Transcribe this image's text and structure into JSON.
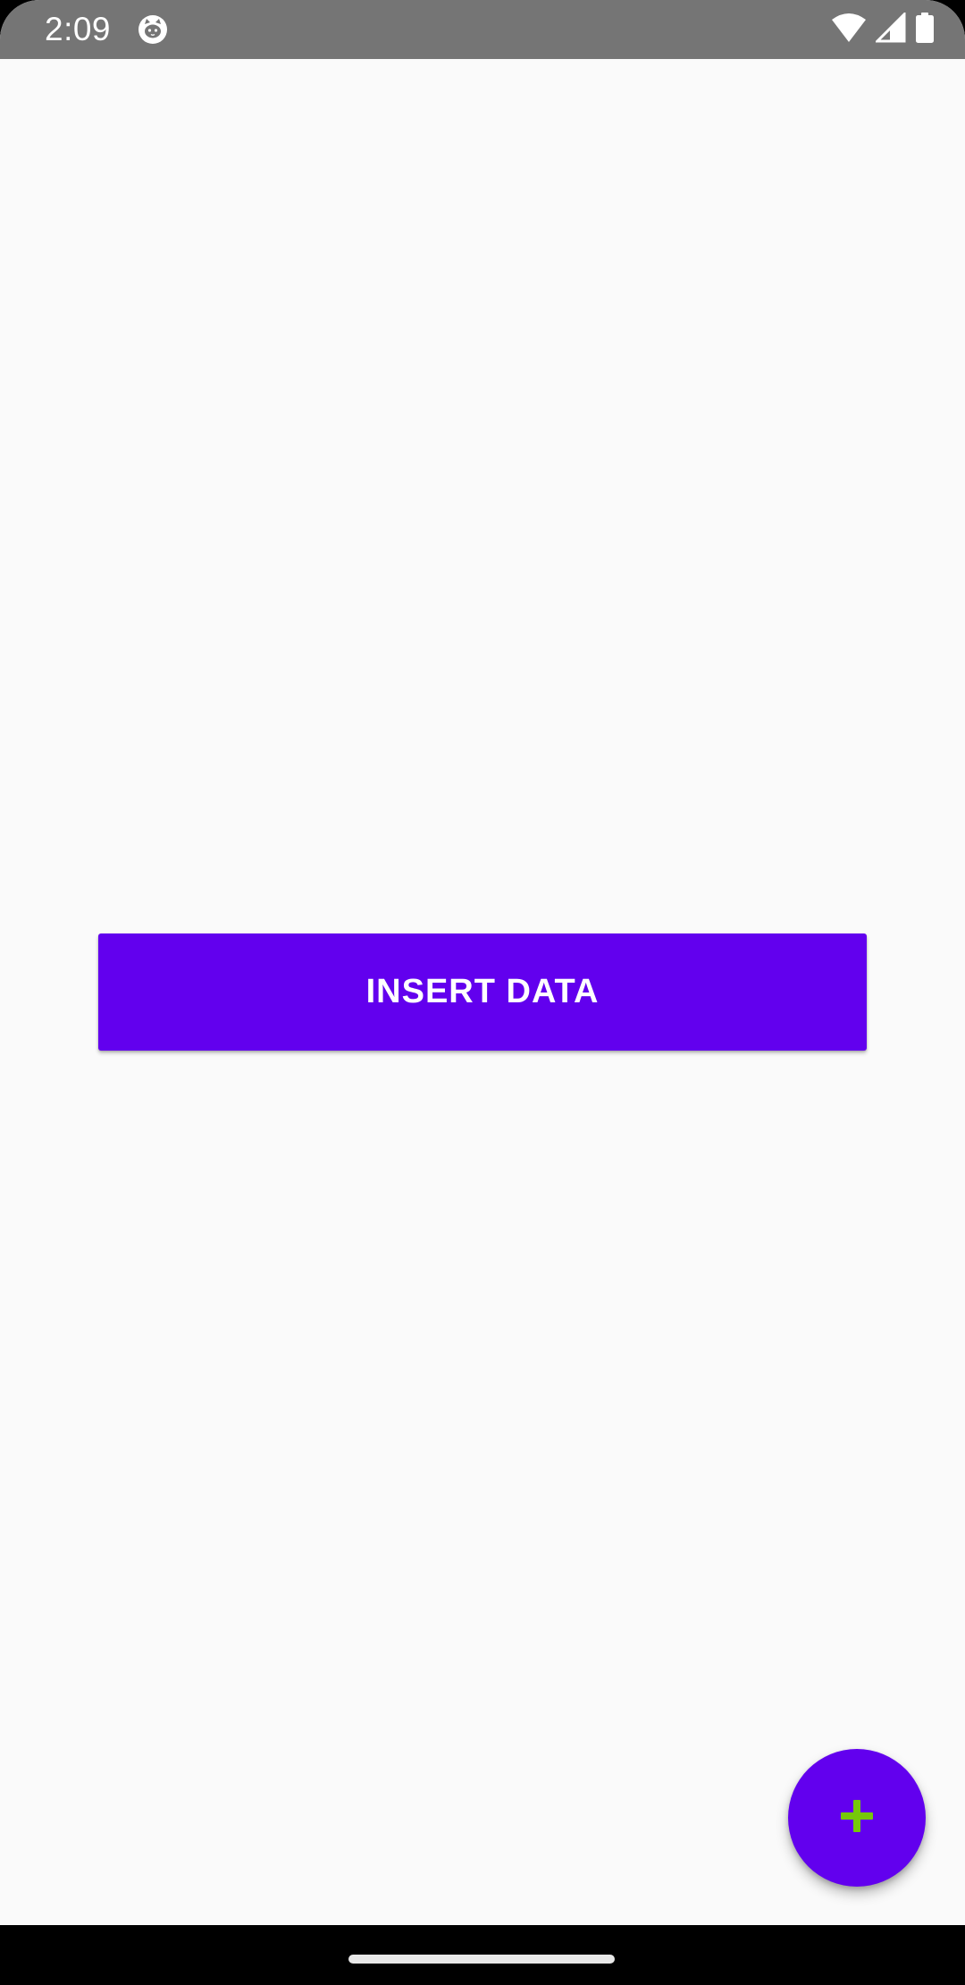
{
  "status_bar": {
    "time": "2:09",
    "notification_icon": "cat-face-icon",
    "icons": [
      "wifi-icon",
      "cell-signal-icon",
      "battery-icon"
    ]
  },
  "main": {
    "insert_button_label": "INSERT DATA"
  },
  "fab": {
    "icon": "plus-icon",
    "icon_color": "#76c80a"
  },
  "colors": {
    "accent": "#6200ee",
    "status_bar": "#757575",
    "background": "#fafafa"
  }
}
